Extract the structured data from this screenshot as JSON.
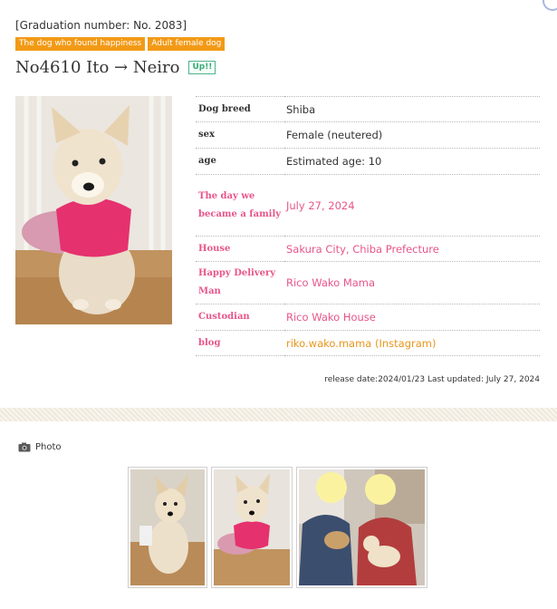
{
  "header": {
    "graduation_number": "[Graduation number: No. 2083]",
    "badges": [
      "The dog who found happiness",
      "Adult female dog"
    ],
    "title": "No4610 Ito → Neiro",
    "up_tag": "Up!!"
  },
  "details": [
    {
      "label": "Dog breed",
      "value": "Shiba"
    },
    {
      "label": "sex",
      "value": "Female (neutered)"
    },
    {
      "label": "age",
      "value": "Estimated age: 10"
    },
    {
      "label": "The day we became a family",
      "value": "July 27, 2024"
    },
    {
      "label": "House",
      "value": "Sakura City, Chiba Prefecture"
    },
    {
      "label": "Happy Delivery Man",
      "value": "Rico Wako Mama"
    },
    {
      "label": "Custodian",
      "value": "Rico Wako House"
    },
    {
      "label": "blog",
      "value": "riko.wako.mama (Instagram)"
    }
  ],
  "release": "release date:2024/01/23   Last updated: July 27, 2024",
  "photo_section": {
    "label": "Photo"
  },
  "colors": {
    "badge": "#f29a16",
    "pink": "#e8558a",
    "link": "#e8961c",
    "up": "#3aa878"
  }
}
